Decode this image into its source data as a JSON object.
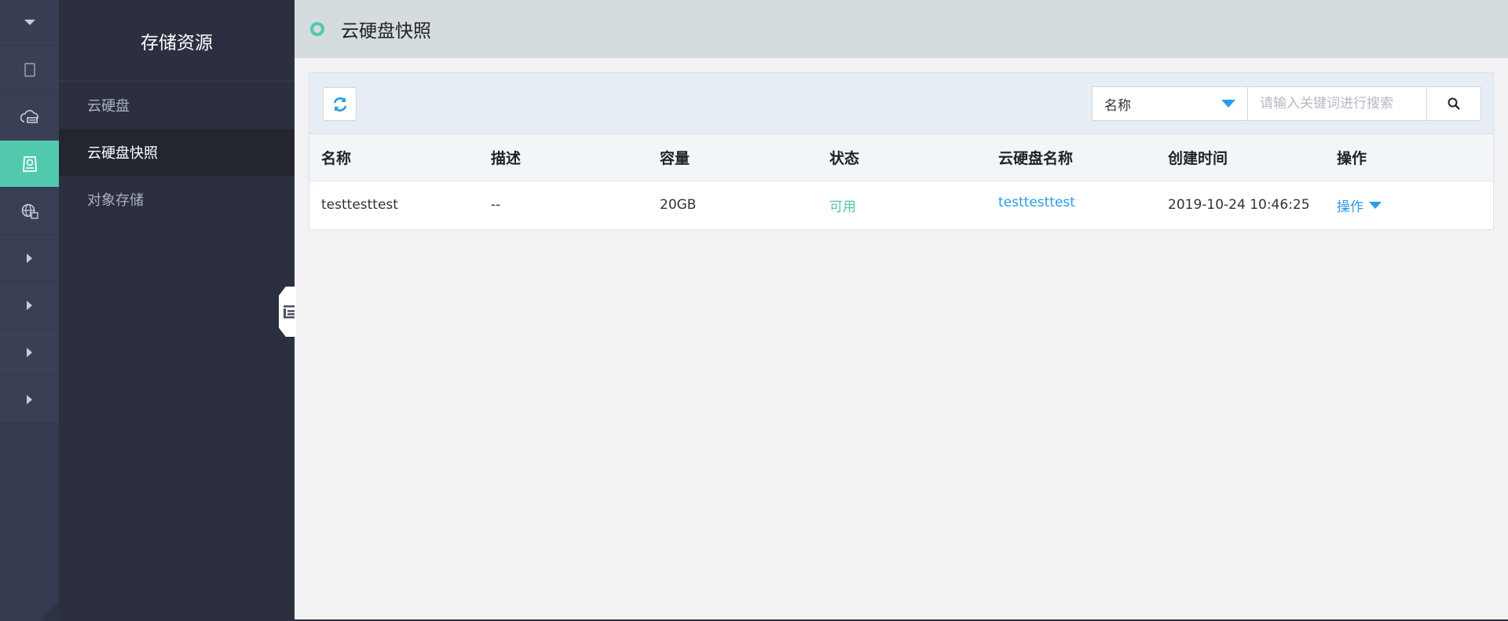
{
  "rail": {
    "items": [
      {
        "icon": "chevron-down-icon"
      },
      {
        "icon": "server-icon"
      },
      {
        "icon": "cloud-disk-icon"
      },
      {
        "icon": "storage-icon"
      },
      {
        "icon": "network-globe-icon"
      },
      {
        "icon": "caret-right-icon"
      },
      {
        "icon": "caret-right-icon"
      },
      {
        "icon": "caret-right-icon"
      },
      {
        "icon": "caret-right-icon"
      }
    ],
    "active_color": "#52c9ad"
  },
  "subnav": {
    "title": "存储资源",
    "items": [
      {
        "label": "云硬盘"
      },
      {
        "label": "云硬盘快照"
      },
      {
        "label": "对象存储"
      }
    ]
  },
  "header": {
    "title": "云硬盘快照"
  },
  "toolbar": {
    "refresh_icon": "refresh-icon",
    "search": {
      "field_selected": "名称",
      "placeholder": "请输入关键词进行搜索",
      "button_icon": "search-icon"
    }
  },
  "table": {
    "columns": [
      "名称",
      "描述",
      "容量",
      "状态",
      "云硬盘名称",
      "创建时间",
      "操作"
    ],
    "rows": [
      {
        "name": "testtesttest",
        "description": "--",
        "capacity": "20GB",
        "status": "可用",
        "disk_name": "testtesttest",
        "created": "2019-10-24 10:46:25",
        "action": "操作"
      }
    ]
  },
  "colors": {
    "accent": "#52c9ad",
    "link": "#2a9ce8",
    "sidebar_bg": "#2c2f3f",
    "rail_bg": "#353a50"
  }
}
